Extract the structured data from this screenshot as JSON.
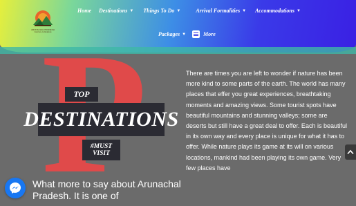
{
  "logo": {
    "caption": "ARUNACHAL PRADESH Journey to Explore"
  },
  "nav": {
    "row1": [
      {
        "label": "Home",
        "dropdown": false
      },
      {
        "label": "Destinations",
        "dropdown": true
      },
      {
        "label": "Things To Do",
        "dropdown": true
      },
      {
        "label": "Arrival Formalities",
        "dropdown": true
      },
      {
        "label": "Accommodations",
        "dropdown": true
      }
    ],
    "row2": [
      {
        "label": "Packages",
        "dropdown": true
      },
      {
        "label": "More",
        "dropdown": false,
        "icon": "document-icon"
      }
    ]
  },
  "hero": {
    "big_letter": "P",
    "top": "TOP",
    "destinations": "DESTINATIONS",
    "must_line1": "#MUST",
    "must_line2": "VISIT"
  },
  "intro": "What more to say about Arunachal Pradesh. It is one of",
  "body": "There are times you are left to wonder if nature has been more kind to some parts of the earth. The world has many places that effer you great experiences, breathtaking moments and amazing views. Some tourist spots have beautiful mountains and stunning valleys; some are deserts but still have a great deal to offer. Each is beautiful in its own way and every place is unique for what it has to offer. While nature plays its game at its will on various locations, mankind had been playing its own game. Very few places have",
  "widgets": {
    "messenger": "messenger-icon",
    "scroll_top": "chevron-up-icon"
  },
  "colors": {
    "accent_red": "#e04a4a",
    "box_dark": "#2b2b33",
    "background": "#6b6b6b",
    "nav_gradient_start": "#e6ef3c",
    "nav_gradient_end": "#3a20e4"
  }
}
